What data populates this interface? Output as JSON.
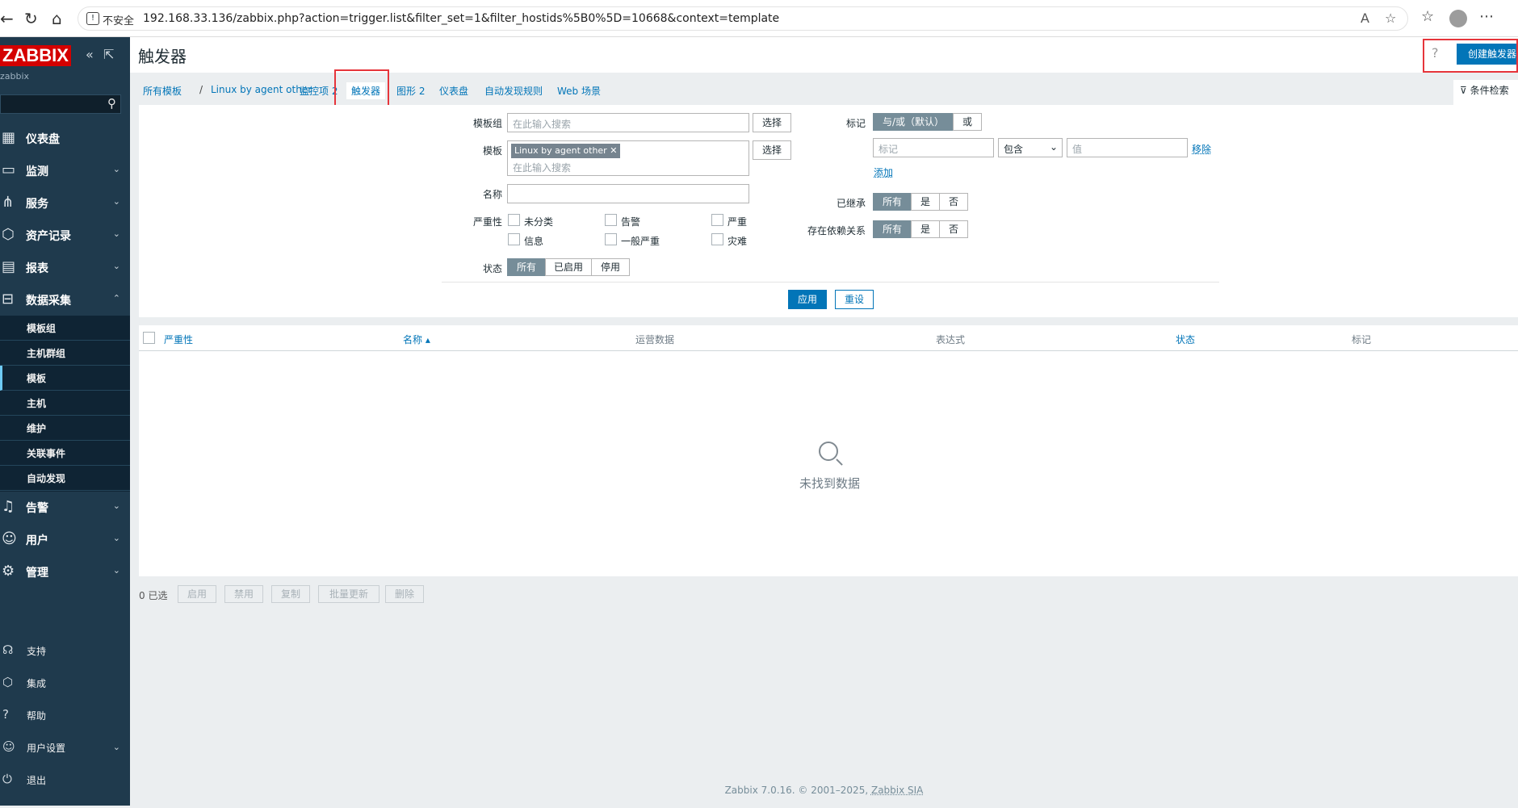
{
  "browser": {
    "insecure_label": "不安全",
    "url": "192.168.33.136/zabbix.php?action=trigger.list&filter_set=1&filter_hostids%5B0%5D=10668&context=template"
  },
  "sidebar": {
    "logo": "ZABBIX",
    "username": "zabbix",
    "menu": [
      {
        "label": "仪表盘",
        "icon": "dashboard-icon"
      },
      {
        "label": "监测",
        "icon": "monitoring-icon"
      },
      {
        "label": "服务",
        "icon": "services-icon"
      },
      {
        "label": "资产记录",
        "icon": "inventory-icon"
      },
      {
        "label": "报表",
        "icon": "reports-icon"
      },
      {
        "label": "数据采集",
        "icon": "data-collection-icon"
      }
    ],
    "submenu": [
      "模板组",
      "主机群组",
      "模板",
      "主机",
      "维护",
      "关联事件",
      "自动发现"
    ],
    "menu2": [
      {
        "label": "告警",
        "icon": "bell-icon"
      },
      {
        "label": "用户",
        "icon": "users-icon"
      },
      {
        "label": "管理",
        "icon": "gear-icon"
      }
    ],
    "bottom": [
      {
        "label": "支持",
        "icon": "headset-icon"
      },
      {
        "label": "集成",
        "icon": "integrations-icon"
      },
      {
        "label": "帮助",
        "icon": "help-icon"
      },
      {
        "label": "用户设置",
        "icon": "user-settings-icon"
      },
      {
        "label": "退出",
        "icon": "power-icon"
      }
    ]
  },
  "header": {
    "title": "触发器",
    "help": "?",
    "create_button": "创建触发器"
  },
  "tabs": {
    "breadcrumb_all": "所有模板",
    "breadcrumb_sep": "/",
    "breadcrumb_template": "Linux by agent other",
    "items": "监控项 2",
    "triggers": "触发器",
    "graphs": "图形 2",
    "dashboards": "仪表盘",
    "discovery": "自动发现规则",
    "web": "Web 场景",
    "filter_toggle": "条件检索"
  },
  "filter": {
    "template_group_label": "模板组",
    "template_group_placeholder": "在此输入搜索",
    "select": "选择",
    "template_label": "模板",
    "template_chip": "Linux by agent other",
    "template_placeholder": "在此输入搜索",
    "name_label": "名称",
    "severity_label": "严重性",
    "severities": [
      "未分类",
      "告警",
      "严重",
      "信息",
      "一般严重",
      "灾难"
    ],
    "status_label": "状态",
    "status_options": [
      "所有",
      "已启用",
      "停用"
    ],
    "tags_label": "标记",
    "tags_op": [
      "与/或（默认）",
      "或"
    ],
    "tag_placeholder": "标记",
    "tag_operator": "包含",
    "tag_value_placeholder": "值",
    "remove": "移除",
    "add": "添加",
    "inherited_label": "已继承",
    "dependencies_label": "存在依赖关系",
    "tri_options": [
      "所有",
      "是",
      "否"
    ],
    "apply": "应用",
    "reset": "重设"
  },
  "table": {
    "columns": [
      "严重性",
      "名称 ▴",
      "运营数据",
      "表达式",
      "状态",
      "标记"
    ],
    "empty_text": "未找到数据"
  },
  "actions": {
    "selected": "0 已选",
    "buttons": [
      "启用",
      "禁用",
      "复制",
      "批量更新",
      "删除"
    ]
  },
  "footer": {
    "text": "Zabbix 7.0.16. © 2001–2025,",
    "link": "Zabbix SIA"
  }
}
